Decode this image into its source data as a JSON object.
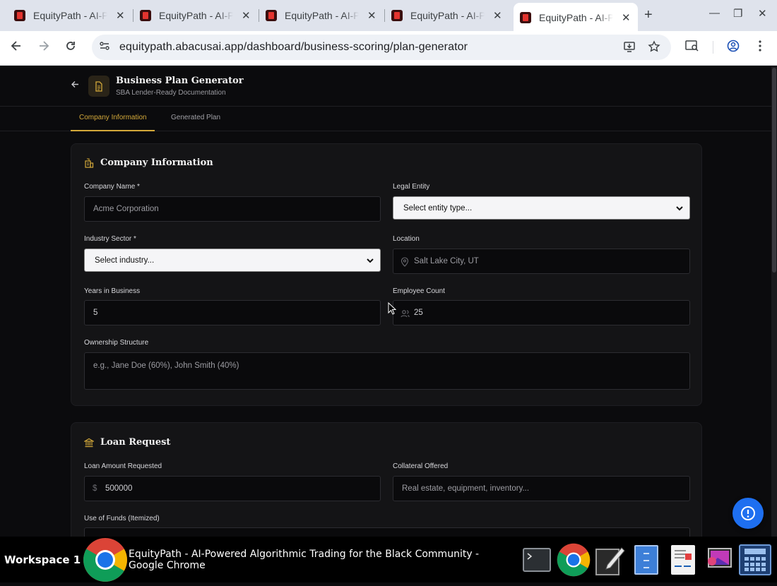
{
  "browser": {
    "tabs": [
      {
        "title": "EquityPath - AI-Powered Algorithmic Trading for the Black Community",
        "active": false
      },
      {
        "title": "EquityPath - AI-Powered Algorithmic Trading for the Black Community",
        "active": false
      },
      {
        "title": "EquityPath - AI-Powered Algorithmic Trading for the Black Community",
        "active": false
      },
      {
        "title": "EquityPath - AI-Powered Algorithmic Trading for the Black Community",
        "active": false
      },
      {
        "title": "EquityPath - AI-Powered Algorithmic Trading for the Black Community",
        "active": true
      }
    ],
    "url": "equitypath.abacusai.app/dashboard/business-scoring/plan-generator"
  },
  "header": {
    "title": "Business Plan Generator",
    "subtitle": "SBA Lender-Ready Documentation"
  },
  "tabs": {
    "company_info": "Company Information",
    "generated_plan": "Generated Plan"
  },
  "company": {
    "section_title": "Company Information",
    "company_name_label": "Company Name *",
    "company_name_placeholder": "Acme Corporation",
    "legal_entity_label": "Legal Entity",
    "legal_entity_value": "Select entity type...",
    "industry_label": "Industry Sector *",
    "industry_value": "Select industry...",
    "location_label": "Location",
    "location_placeholder": "Salt Lake City, UT",
    "years_label": "Years in Business",
    "years_value": "5",
    "employees_label": "Employee Count",
    "employees_value": "25",
    "ownership_label": "Ownership Structure",
    "ownership_placeholder": "e.g., Jane Doe (60%), John Smith (40%)"
  },
  "loan": {
    "section_title": "Loan Request",
    "amount_label": "Loan Amount Requested",
    "amount_prefix": "$",
    "amount_value": "500000",
    "collateral_label": "Collateral Offered",
    "collateral_placeholder": "Real estate, equipment, inventory...",
    "use_of_funds_label": "Use of Funds (Itemized)"
  },
  "taskbar": {
    "workspace": "Workspace 1",
    "window_title": "EquityPath - AI-Powered Algorithmic Trading for the Black Community - Google Chrome"
  },
  "colors": {
    "accent": "#d4a93a",
    "background": "#0b0b0d",
    "card": "#141416",
    "help_button": "#1e6ff0"
  }
}
